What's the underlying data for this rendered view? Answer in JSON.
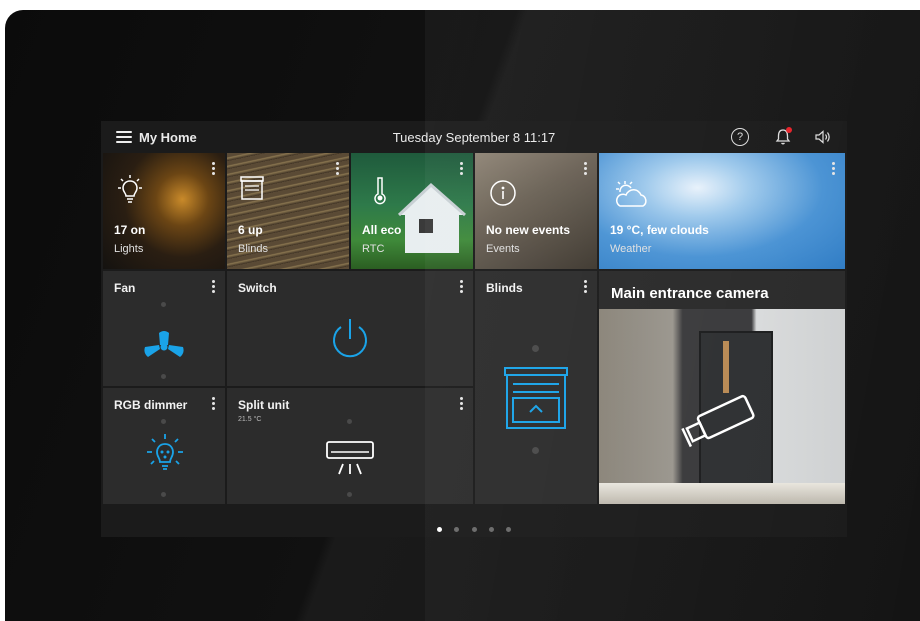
{
  "header": {
    "title": "My Home",
    "datetime": "Tuesday  September 8  11:17"
  },
  "tiles": {
    "lights": {
      "value": "17 on",
      "label": "Lights"
    },
    "blinds_summary": {
      "value": "6 up",
      "label": "Blinds"
    },
    "rtc": {
      "value": "All eco",
      "label": "RTC"
    },
    "events": {
      "value": "No new events",
      "label": "Events"
    },
    "weather": {
      "value": "19 °C, few clouds",
      "label": "Weather"
    },
    "fan": {
      "title": "Fan"
    },
    "switch": {
      "title": "Switch"
    },
    "blinds": {
      "title": "Blinds"
    },
    "rgb": {
      "title": "RGB dimmer"
    },
    "split": {
      "title": "Split unit",
      "temp": "21.5 °C"
    },
    "camera": {
      "title": "Main entrance camera"
    }
  },
  "pager": {
    "pages": 5,
    "active": 0
  },
  "colors": {
    "accent": "#1aa3e8",
    "notification": "#e8222a",
    "tile": "#2c2c2c",
    "background": "#1b1b1b"
  },
  "icons": [
    "menu-icon",
    "help-icon",
    "bell-icon",
    "speaker-icon",
    "lightbulb-icon",
    "blind-icon",
    "thermometer-icon",
    "info-icon",
    "weather-icon",
    "fan-icon",
    "power-icon",
    "rgb-bulb-icon",
    "ac-unit-icon",
    "blinds-control-icon",
    "camera-icon",
    "kebab-icon"
  ]
}
